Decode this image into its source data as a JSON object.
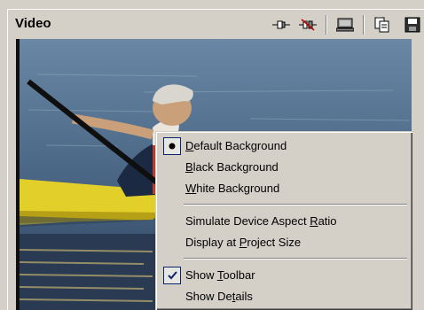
{
  "panel": {
    "title": "Video"
  },
  "toolbar": {
    "buttons": [
      {
        "icon": "connect-icon"
      },
      {
        "icon": "disconnect-icon"
      },
      {
        "icon": "monitor-icon"
      },
      {
        "icon": "copy-frame-icon"
      },
      {
        "icon": "save-frame-icon"
      }
    ]
  },
  "menu": {
    "items": [
      {
        "pre": "",
        "key": "D",
        "post": "efault Background",
        "state": "radio-selected"
      },
      {
        "pre": "",
        "key": "B",
        "post": "lack Background",
        "state": "none"
      },
      {
        "pre": "",
        "key": "W",
        "post": "hite Background",
        "state": "none"
      },
      {
        "pre": "Simulate Device Aspect ",
        "key": "R",
        "post": "atio",
        "state": "none"
      },
      {
        "pre": "Display at ",
        "key": "P",
        "post": "roject Size",
        "state": "none"
      },
      {
        "pre": "Show ",
        "key": "T",
        "post": "oolbar",
        "state": "checked"
      },
      {
        "pre": "Show De",
        "key": "t",
        "post": "ails",
        "state": "none"
      }
    ]
  },
  "colors": {
    "panel_bg": "#d4d0c8",
    "check_blue": "#0a246a",
    "water": "#4b6580",
    "kayak": "#e2cf2a"
  }
}
